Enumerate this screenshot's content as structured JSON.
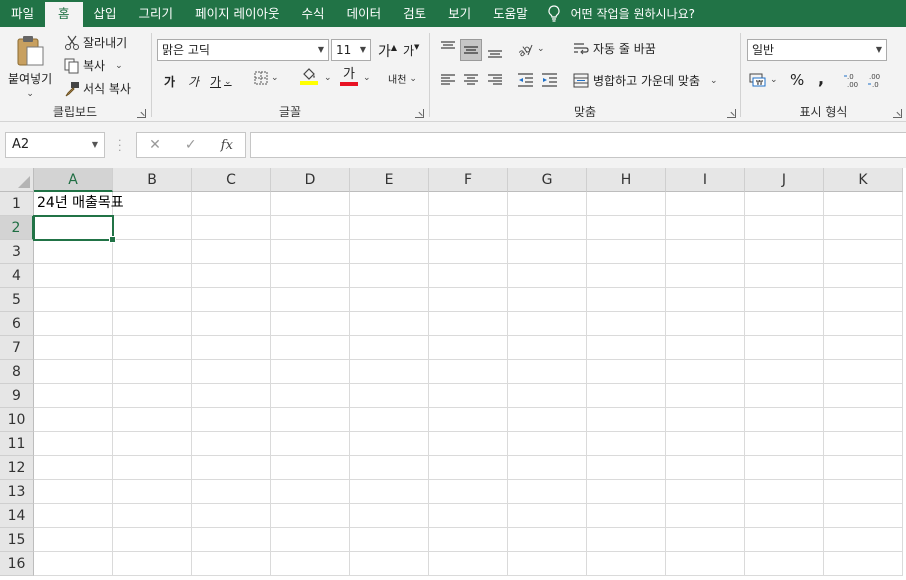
{
  "tabs": [
    "파일",
    "홈",
    "삽입",
    "그리기",
    "페이지 레이아웃",
    "수식",
    "데이터",
    "검토",
    "보기",
    "도움말"
  ],
  "active_tab": "홈",
  "tell_me": "어떤 작업을 원하시나요?",
  "ribbon": {
    "clipboard": {
      "paste": "붙여넣기",
      "cut": "잘라내기",
      "copy": "복사",
      "format_painter": "서식 복사",
      "label": "클립보드"
    },
    "font": {
      "name": "맑은 고딕",
      "size": "11",
      "grow": "가",
      "shrink": "가",
      "bold": "가",
      "italic": "가",
      "underline": "가",
      "font_color_glyph": "가",
      "phonetic": "내천",
      "label": "글꼴",
      "fill_color": "#ffff00",
      "font_color": "#e81123"
    },
    "alignment": {
      "wrap_text": "자동 줄 바꿈",
      "merge_center": "병합하고 가운데 맞춤",
      "label": "맞춤"
    },
    "number": {
      "format": "일반",
      "percent": "%",
      "comma": ",",
      "label": "표시 형식"
    }
  },
  "formula_bar": {
    "name_box": "A2",
    "cancel": "✕",
    "enter": "✓",
    "fx": "fx",
    "value": ""
  },
  "sheet": {
    "columns": [
      "A",
      "B",
      "C",
      "D",
      "E",
      "F",
      "G",
      "H",
      "I",
      "J",
      "K"
    ],
    "rows": [
      "1",
      "2",
      "3",
      "4",
      "5",
      "6",
      "7",
      "8",
      "9",
      "10",
      "11",
      "12",
      "13",
      "14",
      "15",
      "16"
    ],
    "cells": {
      "A1": "24년 매출목표"
    },
    "active_cell": "A2"
  },
  "colors": {
    "accent": "#217346"
  }
}
